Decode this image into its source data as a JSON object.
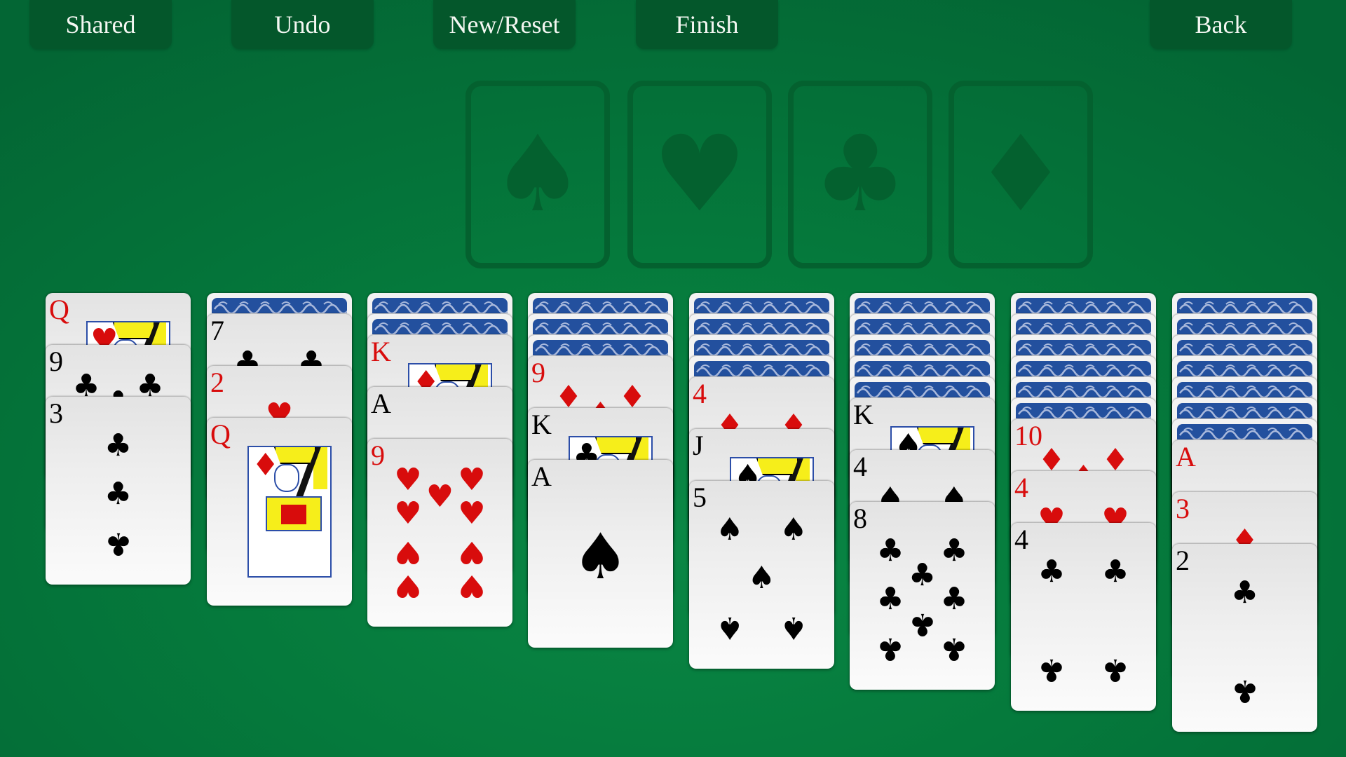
{
  "toolbar": {
    "buttons": [
      {
        "id": "shared",
        "label": "Shared"
      },
      {
        "id": "undo",
        "label": "Undo"
      },
      {
        "id": "new-reset",
        "label": "New/Reset"
      },
      {
        "id": "finish",
        "label": "Finish"
      },
      {
        "id": "back",
        "label": "Back"
      }
    ]
  },
  "foundations": [
    {
      "suit": "spades",
      "glyph": "♠",
      "cards": []
    },
    {
      "suit": "hearts",
      "glyph": "♥",
      "cards": []
    },
    {
      "suit": "clubs",
      "glyph": "♣",
      "cards": []
    },
    {
      "suit": "diamonds",
      "glyph": "♦",
      "cards": []
    }
  ],
  "tableau": [
    {
      "face_down": 0,
      "face_up": [
        {
          "rank": "Q",
          "suit": "♥",
          "color": "red"
        },
        {
          "rank": "9",
          "suit": "♣",
          "color": "black"
        },
        {
          "rank": "3",
          "suit": "♣",
          "color": "black"
        }
      ]
    },
    {
      "face_down": 1,
      "face_up": [
        {
          "rank": "7",
          "suit": "♣",
          "color": "black"
        },
        {
          "rank": "2",
          "suit": "♥",
          "color": "red"
        },
        {
          "rank": "Q",
          "suit": "♦",
          "color": "red"
        }
      ]
    },
    {
      "face_down": 2,
      "face_up": [
        {
          "rank": "K",
          "suit": "♦",
          "color": "red"
        },
        {
          "rank": "A",
          "suit": "",
          "color": "black"
        },
        {
          "rank": "9",
          "suit": "♥",
          "color": "red"
        }
      ]
    },
    {
      "face_down": 3,
      "face_up": [
        {
          "rank": "9",
          "suit": "♦",
          "color": "red"
        },
        {
          "rank": "K",
          "suit": "♣",
          "color": "black"
        },
        {
          "rank": "A",
          "suit": "♠",
          "color": "black"
        }
      ]
    },
    {
      "face_down": 4,
      "face_up": [
        {
          "rank": "4",
          "suit": "♦",
          "color": "red"
        },
        {
          "rank": "J",
          "suit": "♠",
          "color": "black"
        },
        {
          "rank": "5",
          "suit": "♠",
          "color": "black"
        }
      ]
    },
    {
      "face_down": 5,
      "face_up": [
        {
          "rank": "K",
          "suit": "♠",
          "color": "black"
        },
        {
          "rank": "4",
          "suit": "♠",
          "color": "black"
        },
        {
          "rank": "8",
          "suit": "♣",
          "color": "black"
        }
      ]
    },
    {
      "face_down": 6,
      "face_up": [
        {
          "rank": "10",
          "suit": "♦",
          "color": "red"
        },
        {
          "rank": "4",
          "suit": "♥",
          "color": "red"
        },
        {
          "rank": "4",
          "suit": "♣",
          "color": "black"
        }
      ]
    },
    {
      "face_down": 7,
      "face_up": [
        {
          "rank": "A",
          "suit": "♦",
          "color": "red"
        },
        {
          "rank": "3",
          "suit": "♦",
          "color": "red"
        },
        {
          "rank": "2",
          "suit": "♣",
          "color": "black"
        }
      ]
    }
  ],
  "colors": {
    "felt": "#057a3c",
    "button_bg": "#04572b",
    "card_back": "#23509e",
    "red_suit": "#d80c0c"
  }
}
